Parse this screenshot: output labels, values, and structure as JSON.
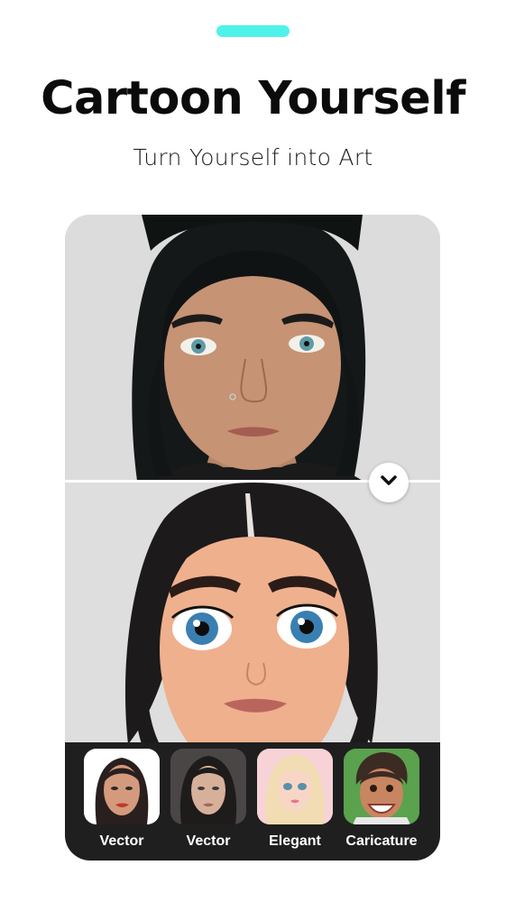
{
  "header": {
    "title": "Cartoon Yourself",
    "subtitle": "Turn Yourself into Art",
    "accent_color": "#4ff2ea"
  },
  "comparison": {
    "top_image": "real-photo-portrait",
    "bottom_image": "cartoon-portrait",
    "handle_icon": "chevron-down-icon"
  },
  "styles": {
    "items": [
      {
        "label": "Vector",
        "thumb": "vector-style-thumbnail",
        "bg": "#ffffff"
      },
      {
        "label": "Vector",
        "thumb": "vector-realistic-thumbnail",
        "bg": "#3a3a3a"
      },
      {
        "label": "Elegant",
        "thumb": "elegant-style-thumbnail",
        "bg": "#f4c8cf"
      },
      {
        "label": "Caricature",
        "thumb": "caricature-style-thumbnail",
        "bg": "#5aa24e"
      }
    ]
  }
}
